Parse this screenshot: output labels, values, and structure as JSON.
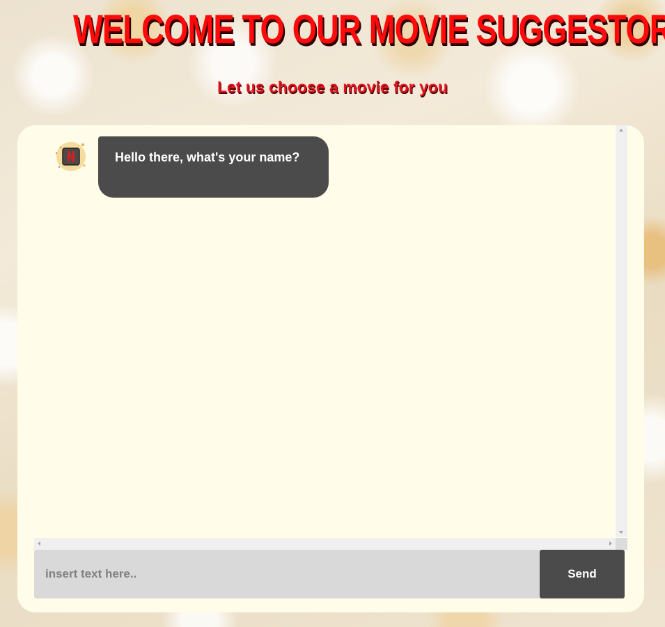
{
  "header": {
    "title": "WELCOME TO OUR MOVIE SUGGESTOR!",
    "subtitle": "Let us choose a movie for you"
  },
  "chat": {
    "messages": [
      {
        "sender": "bot",
        "avatar_icon": "netflix-logo-icon",
        "text": "Hello there, what's your name?"
      }
    ]
  },
  "composer": {
    "placeholder": "insert text here..",
    "value": "",
    "send_label": "Send"
  },
  "colors": {
    "title_red": "#ff0a0a",
    "subtitle_red": "#e0121e",
    "panel_bg": "#fffde9",
    "bubble_bg": "#4b4b4b",
    "input_bg": "#d9d9d9",
    "send_bg": "#4b4b4b"
  }
}
